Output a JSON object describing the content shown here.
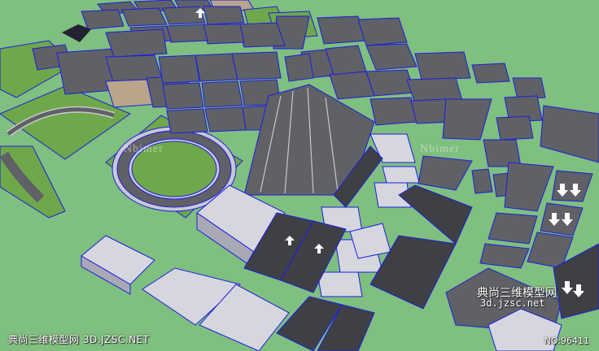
{
  "scene": {
    "description_tag": "sketchup-road-model-library",
    "colors": {
      "ground": "#7fbf7f",
      "road": "#5f6166",
      "road_dark": "#3f4046",
      "curb": "#c8c8d0",
      "grass": "#6ea84a",
      "grass_dark": "#5a923b",
      "edge": "#1d1de0",
      "sand": "#b8a58a",
      "block_top": "#d6d6de",
      "block_side": "#a9a9b6"
    }
  },
  "watermarks": {
    "left_text": "典尚三维模型网 3D.JZSC.NET",
    "id_text": "NO:96411",
    "brand_line1": "典尚三维模型网",
    "brand_line2": "3d.jzsc.net",
    "faint1": "Nbimer",
    "faint2": "Nbimer"
  }
}
